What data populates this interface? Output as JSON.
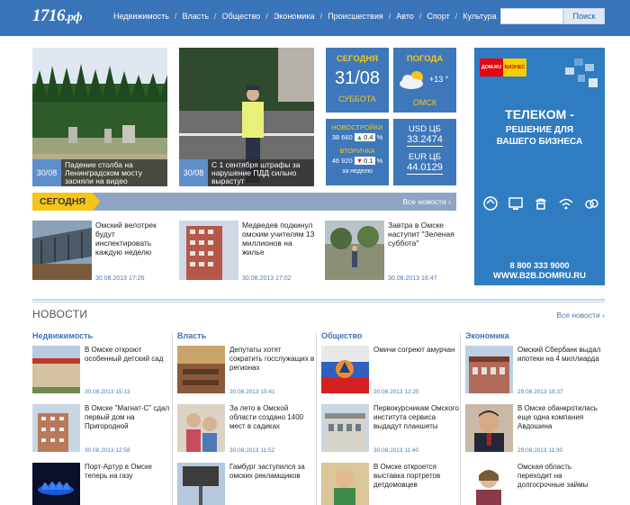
{
  "header": {
    "logo_main": "1716",
    "logo_suffix": ".рф",
    "nav": [
      "Недвижимость",
      "Власть",
      "Общество",
      "Экономика",
      "Происшествия",
      "Авто",
      "Спорт",
      "Культура"
    ],
    "search_button": "Поиск"
  },
  "hero": [
    {
      "date": "30/08",
      "caption": "Падение столба на Ленинградском мосту засняли на видео"
    },
    {
      "date": "30/08",
      "caption": "С 1 сентября штрафы за нарушение ПДД сильно вырастут"
    }
  ],
  "widgets": {
    "today_title": "СЕГОДНЯ",
    "today_date": "31/08",
    "today_day": "СУББОТА",
    "weather_title": "ПОГОДА",
    "weather_temp": "+13 °",
    "weather_city": "ОМСК",
    "new_title": "НОВОСТРОЙКИ",
    "new_value": "38 660",
    "new_change": "0.4",
    "second_title": "ВТОРИЧКА",
    "second_value": "46 920",
    "second_change": "0.1",
    "percent": "%",
    "per_week": "за неделю",
    "usd_label": "USD ЦБ",
    "usd_value": "33.2474",
    "eur_label": "EUR ЦБ",
    "eur_value": "44.0129",
    "up_color": "#2e9b3a",
    "down_color": "#d62020"
  },
  "ad": {
    "logo_left": "ДОМ.RU",
    "logo_right": "БИЗНЕС",
    "headline": "ТЕЛЕКОМ -",
    "subline1": "РЕШЕНИЕ ДЛЯ",
    "subline2": "ВАШЕГО БИЗНЕСА",
    "phone": "8 800 333 9000",
    "site": "WWW.B2B.DOMRU.RU"
  },
  "today_section": {
    "label": "СЕГОДНЯ",
    "all_link": "Все новости ›",
    "items": [
      {
        "title": "Омский велотрек будут инспектировать каждую неделю",
        "date": "30.08.2013 17:26"
      },
      {
        "title": "Медведев подкинул омским учителям 13 миллионов на жилье",
        "date": "30.08.2013 17:02"
      },
      {
        "title": "Завтра в Омске наступит \"Зеленая суббота\"",
        "date": "30.08.2013 16:47"
      }
    ]
  },
  "news": {
    "title": "НОВОСТИ",
    "all_link": "Все новости ›",
    "columns": [
      {
        "heading": "Недвижимость",
        "items": [
          {
            "title": "В Омске откроют особенный детский сад",
            "date": "30.08.2013 15:13"
          },
          {
            "title": "В Омске \"Магнат-С\" сдал первый дом на Пригородной",
            "date": "30.08.2013 12:58"
          },
          {
            "title": "Порт-Артур в Омске теперь на газу",
            "date": ""
          }
        ]
      },
      {
        "heading": "Власть",
        "items": [
          {
            "title": "Депутаты хотят сократить госслужащих в регионах",
            "date": "30.08.2013 15:41"
          },
          {
            "title": "За лето в Омской области создано 1400 мест в садиках",
            "date": "30.08.2013 11:52"
          },
          {
            "title": "Гамбург заступился за омских рекламщиков",
            "date": ""
          }
        ]
      },
      {
        "heading": "Общество",
        "items": [
          {
            "title": "Омичи согреют амурчан",
            "date": "30.08.2013 12:25"
          },
          {
            "title": "Первокурсникам Омского института сервиса выдадут планшеты",
            "date": "30.08.2013 11:40"
          },
          {
            "title": "В Омске откроется выставка портретов детдомовцев",
            "date": ""
          }
        ]
      },
      {
        "heading": "Экономика",
        "items": [
          {
            "title": "Омский Сбербанк выдал ипотеки на 4 миллиарда",
            "date": "29.08.2013 18:37"
          },
          {
            "title": "В Омске обанкротилась еще одна компания Авдошина",
            "date": "29.08.2013 11:30"
          },
          {
            "title": "Омская область переходит на долгосрочные займы",
            "date": ""
          }
        ]
      }
    ]
  }
}
